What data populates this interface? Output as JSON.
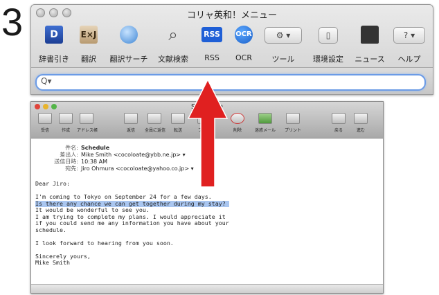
{
  "step_number": "3",
  "app": {
    "title": "コリャ英和！メニュー",
    "toolbar": [
      {
        "id": "dict",
        "label": "辞書引き",
        "icon_text": "D"
      },
      {
        "id": "translate",
        "label": "翻訳",
        "icon_text": "E×J"
      },
      {
        "id": "translate-search",
        "label": "翻訳サーチ",
        "icon_text": ""
      },
      {
        "id": "doc-search",
        "label": "文献検索",
        "icon_text": "🔍"
      },
      {
        "id": "rss",
        "label": "RSS",
        "icon_text": "RSS"
      },
      {
        "id": "ocr",
        "label": "OCR",
        "icon_text": "OCR"
      },
      {
        "id": "tools",
        "label": "ツール",
        "icon_text": "⚙ ▾"
      },
      {
        "id": "prefs",
        "label": "環境設定",
        "icon_text": "▯"
      },
      {
        "id": "news",
        "label": "ニュース",
        "icon_text": ""
      },
      {
        "id": "help",
        "label": "ヘルプ",
        "icon_text": "? ▾"
      }
    ],
    "search": {
      "icon": "Q▾",
      "value": ""
    }
  },
  "mail": {
    "title": "Schedule",
    "toolbar": [
      {
        "label": "受信"
      },
      {
        "label": "作成"
      },
      {
        "label": "アドレス帳"
      },
      {
        "label": "返信"
      },
      {
        "label": "全員に返信"
      },
      {
        "label": "転送"
      },
      {
        "label": "フラグ"
      },
      {
        "label": "削除"
      },
      {
        "label": "迷惑メール"
      },
      {
        "label": "プリント"
      },
      {
        "label": "戻る"
      },
      {
        "label": "進む"
      }
    ],
    "headers": {
      "subject_key": "件名:",
      "subject": "Schedule",
      "from_key": "差出人:",
      "from": "Mike Smith <cocoloate@ybb.ne.jp> ▾",
      "date_key": "送信日時:",
      "date": "10:38 AM",
      "to_key": "宛先:",
      "to": "Jiro Ohmura <cocoloate@yahoo.co.jp> ▾"
    },
    "body": {
      "greeting": "Dear Jiro:",
      "line1": "I'm coming to Tokyo on September 24 for a few days.",
      "line2_highlighted": "Is there any chance we can get together during my stay?",
      "line3": "It would be wonderful to see you.",
      "line4": "I am trying to complete my plans. I would appreciate it",
      "line5": "if you could send me any information you have about your",
      "line6": "schedule.",
      "line7": "I look forward to hearing from you soon.",
      "closing1": "Sincerely yours,",
      "closing2": "Mike Smith"
    }
  },
  "colors": {
    "arrow": "#e02020",
    "highlight": "#a9c6f0",
    "search_border": "#6b9be6"
  }
}
